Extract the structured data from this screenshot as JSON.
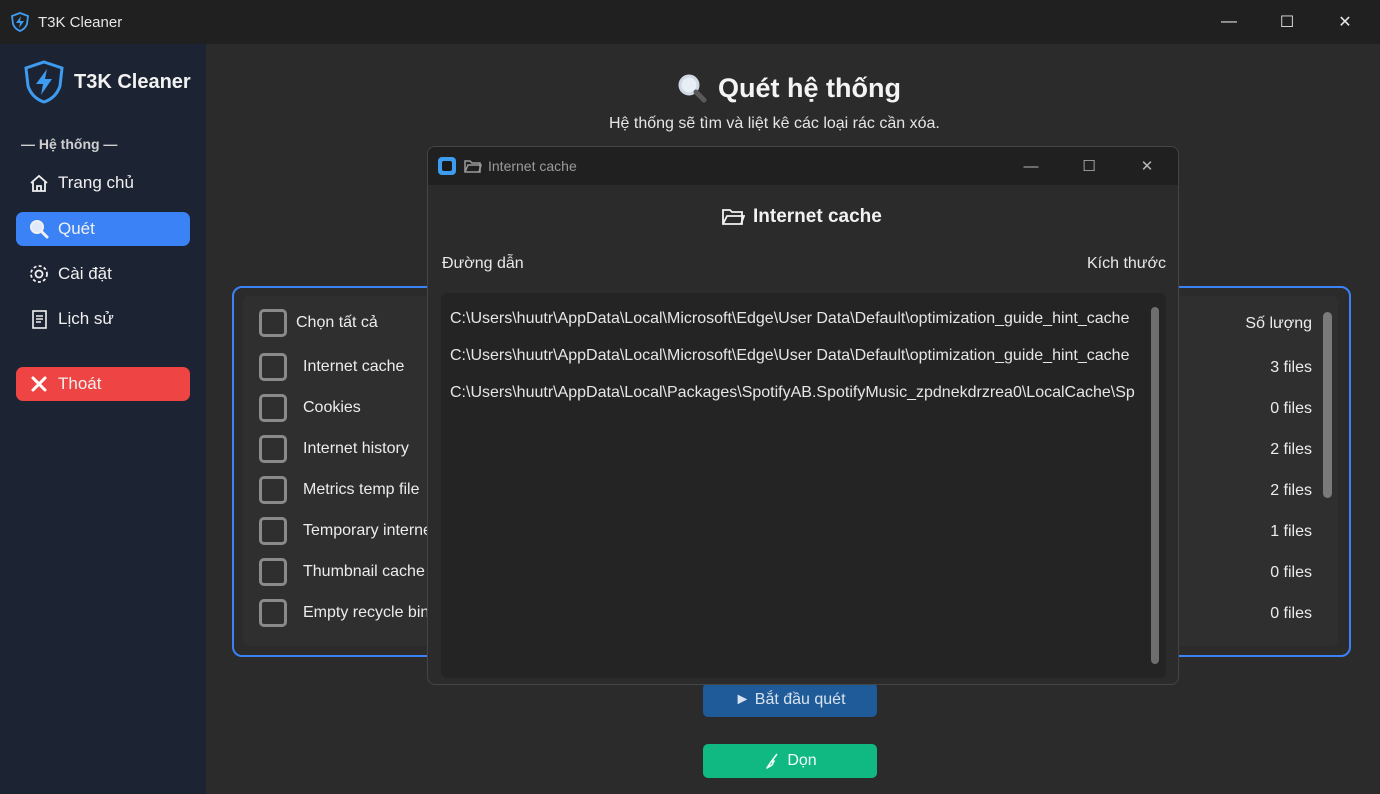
{
  "window": {
    "title": "T3K Cleaner",
    "controls": {
      "minimize": "—",
      "maximize": "☐",
      "close": "✕"
    }
  },
  "sidebar": {
    "brand": "T3K Cleaner",
    "section_label": "— Hệ thống —",
    "items": [
      {
        "label": "Trang chủ",
        "icon": "home-icon"
      },
      {
        "label": "Quét",
        "icon": "search-icon",
        "active": true
      },
      {
        "label": "Cài đặt",
        "icon": "gear-icon"
      },
      {
        "label": "Lịch sử",
        "icon": "history-icon"
      }
    ],
    "exit": {
      "label": "Thoát",
      "icon": "close-icon"
    }
  },
  "main": {
    "title": "Quét hệ thống",
    "subtitle": "Hệ thống sẽ tìm và liệt kê các loại rác cần xóa.",
    "select_all": "Chọn tất cả",
    "count_header": "Số lượng",
    "rows": [
      {
        "label": "Internet cache",
        "count": "3 files"
      },
      {
        "label": "Cookies",
        "count": "0 files"
      },
      {
        "label": "Internet history",
        "count": "2 files"
      },
      {
        "label": "Metrics temp file",
        "count": "2 files"
      },
      {
        "label": "Temporary interne",
        "count": "1 files"
      },
      {
        "label": "Thumbnail cache",
        "count": "0 files"
      },
      {
        "label": "Empty recycle bin",
        "count": "0 files"
      }
    ],
    "scan_button": "► Bắt đầu quét",
    "clean_button": "Dọn"
  },
  "dialog": {
    "window_title": "Internet cache",
    "heading": "Internet cache",
    "col_path": "Đường dẫn",
    "col_size": "Kích thước",
    "paths": [
      "C:\\Users\\huutr\\AppData\\Local\\Microsoft\\Edge\\User Data\\Default\\optimization_guide_hint_cache",
      "C:\\Users\\huutr\\AppData\\Local\\Microsoft\\Edge\\User Data\\Default\\optimization_guide_hint_cache",
      "C:\\Users\\huutr\\AppData\\Local\\Packages\\SpotifyAB.SpotifyMusic_zpdnekdrzrea0\\LocalCache\\Sp"
    ],
    "controls": {
      "minimize": "—",
      "maximize": "☐",
      "close": "✕"
    }
  },
  "colors": {
    "accent": "#3b82f6",
    "danger": "#ef4444",
    "success": "#10b981",
    "sidebar_bg": "#1c2333"
  }
}
